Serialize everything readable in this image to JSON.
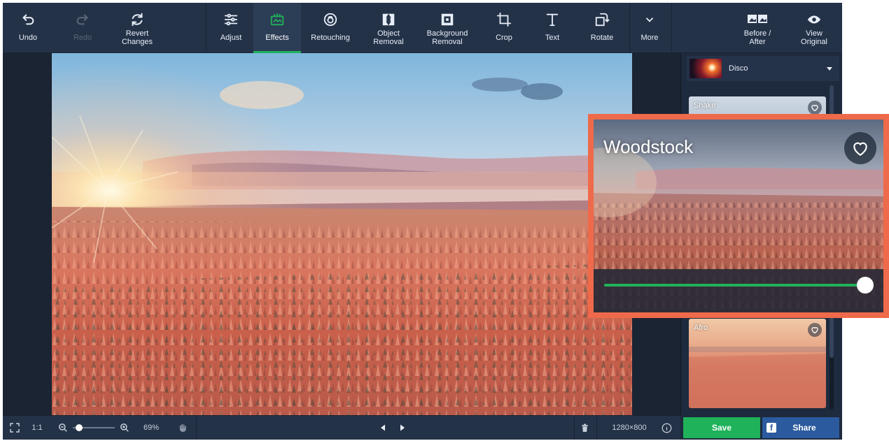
{
  "toolbar": {
    "undo": "Undo",
    "redo": "Redo",
    "revert": "Revert\nChanges",
    "adjust": "Adjust",
    "effects": "Effects",
    "retouching": "Retouching",
    "object_removal": "Object\nRemoval",
    "background_removal": "Background\nRemoval",
    "crop": "Crop",
    "text": "Text",
    "rotate": "Rotate",
    "more": "More",
    "before_after": "Before /\nAfter",
    "view_original": "View\nOriginal",
    "active_tab": "Effects",
    "accent_color": "#1fb25a"
  },
  "effects_panel": {
    "category": "Disco",
    "cards": [
      {
        "name": "Shake"
      },
      {
        "name": "Afro"
      }
    ]
  },
  "callout": {
    "title": "Woodstock",
    "intensity": 1.0,
    "border_color": "#ef6a4a"
  },
  "bottombar": {
    "zoom_actual": "1:1",
    "zoom_percent": "69%",
    "dimensions": "1280×800"
  },
  "actions": {
    "save": "Save",
    "share": "Share"
  }
}
